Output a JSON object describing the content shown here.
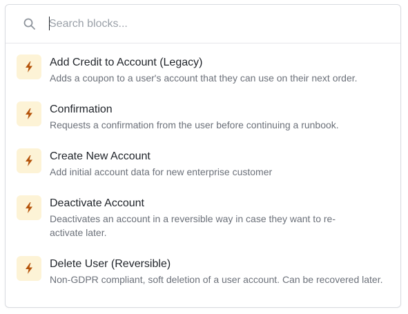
{
  "search": {
    "placeholder": "Search blocks...",
    "value": "",
    "icon": "search-icon"
  },
  "colors": {
    "icon_bg": "#fdf3d6",
    "icon_fg": "#b4530a",
    "title": "#1f2329",
    "description": "#6b7079"
  },
  "blocks": [
    {
      "icon": "lightning-icon",
      "title": "Add Credit to Account (Legacy)",
      "description": "Adds a coupon to a user's account that they can use on their next order."
    },
    {
      "icon": "lightning-icon",
      "title": "Confirmation",
      "description": "Requests a confirmation from the user before continuing a runbook."
    },
    {
      "icon": "lightning-icon",
      "title": "Create New Account",
      "description": "Add initial account data for new enterprise customer"
    },
    {
      "icon": "lightning-icon",
      "title": "Deactivate Account",
      "description": "Deactivates an account in a reversible way in case they want to re-activate later."
    },
    {
      "icon": "lightning-icon",
      "title": "Delete User (Reversible)",
      "description": "Non-GDPR compliant, soft deletion of a user account. Can be recovered later."
    }
  ]
}
